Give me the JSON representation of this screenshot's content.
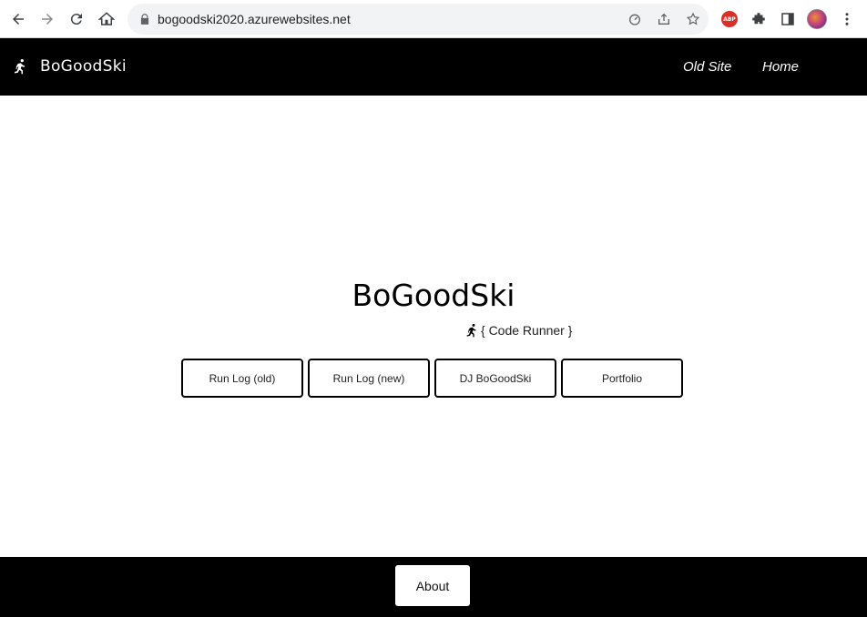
{
  "browser": {
    "url": "bogoodski2020.azurewebsites.net",
    "icons": [
      "back-icon",
      "forward-icon",
      "reload-icon",
      "home-icon",
      "lock-icon",
      "speed-icon",
      "share-icon",
      "star-icon",
      "adblock-icon",
      "extensions-icon",
      "sidepanel-icon",
      "profile-avatar",
      "menu-icon"
    ],
    "adblock_label": "ABP"
  },
  "header": {
    "brand": "BoGoodSki",
    "nav": [
      {
        "label": "Old Site"
      },
      {
        "label": "Home"
      }
    ]
  },
  "hero": {
    "title": "BoGoodSki",
    "subtitle": "{ Code Runner }"
  },
  "buttons": [
    {
      "label": "Run Log (old)"
    },
    {
      "label": "Run Log (new)"
    },
    {
      "label": "DJ BoGoodSki"
    },
    {
      "label": "Portfolio"
    }
  ],
  "footer": {
    "about_label": "About"
  },
  "colors": {
    "header_bg": "#000000",
    "footer_bg": "#000000",
    "page_bg": "#ffffff",
    "omnibox_bg": "#f1f3f4",
    "adblock": "#d93025"
  }
}
